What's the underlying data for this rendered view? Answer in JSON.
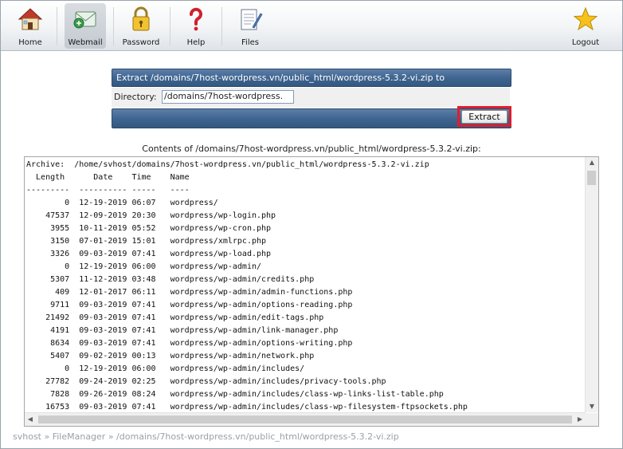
{
  "toolbar": {
    "home_label": "Home",
    "webmail_label": "Webmail",
    "password_label": "Password",
    "help_label": "Help",
    "files_label": "Files",
    "logout_label": "Logout"
  },
  "extract": {
    "title": "Extract /domains/7host-wordpress.vn/public_html/wordpress-5.3.2-vi.zip to",
    "directory_label": "Directory:",
    "directory_value": "/domains/7host-wordpress.",
    "button_label": "Extract",
    "highlight_color": "#e21c2a"
  },
  "contents": {
    "title": "Contents of /domains/7host-wordpress.vn/public_html/wordpress-5.3.2-vi.zip:",
    "listing": "Archive:  /home/svhost/domains/7host-wordpress.vn/public_html/wordpress-5.3.2-vi.zip\n  Length      Date    Time    Name\n---------  ---------- -----   ----\n        0  12-19-2019 06:07   wordpress/\n    47537  12-09-2019 20:30   wordpress/wp-login.php\n     3955  10-11-2019 05:52   wordpress/wp-cron.php\n     3150  07-01-2019 15:01   wordpress/xmlrpc.php\n     3326  09-03-2019 07:41   wordpress/wp-load.php\n        0  12-19-2019 06:00   wordpress/wp-admin/\n     5307  11-12-2019 03:48   wordpress/wp-admin/credits.php\n      409  12-01-2017 06:11   wordpress/wp-admin/admin-functions.php\n     9711  09-03-2019 07:41   wordpress/wp-admin/options-reading.php\n    21492  09-03-2019 07:41   wordpress/wp-admin/edit-tags.php\n     4191  09-03-2019 07:41   wordpress/wp-admin/link-manager.php\n     8634  09-03-2019 07:41   wordpress/wp-admin/options-writing.php\n     5407  09-02-2019 00:13   wordpress/wp-admin/network.php\n        0  12-19-2019 06:00   wordpress/wp-admin/includes/\n    27782  09-24-2019 02:25   wordpress/wp-admin/includes/privacy-tools.php\n     7828  09-26-2019 08:24   wordpress/wp-admin/includes/class-wp-links-list-table.php\n    16753  09-03-2019 07:41   wordpress/wp-admin/includes/class-wp-filesystem-ftpsockets.php"
  },
  "breadcrumb": "svhost » FileManager » /domains/7host-wordpress.vn/public_html/wordpress-5.3.2-vi.zip"
}
